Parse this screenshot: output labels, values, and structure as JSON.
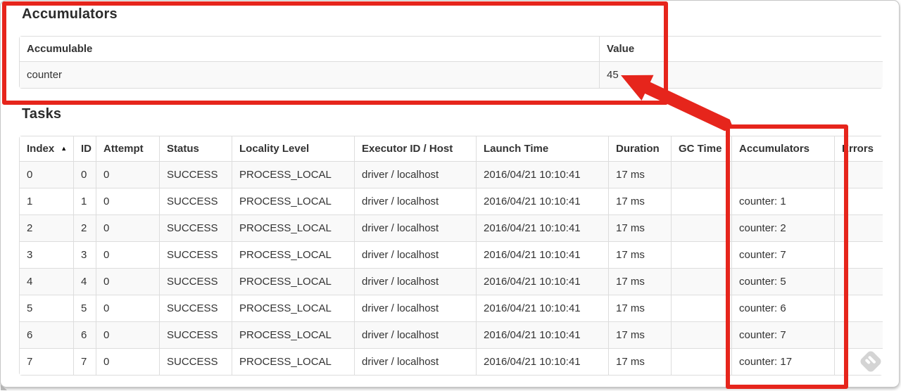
{
  "accumulators_section": {
    "title": "Accumulators",
    "table": {
      "headers": [
        "Accumulable",
        "Value"
      ],
      "rows": [
        [
          "counter",
          "45"
        ]
      ]
    }
  },
  "tasks_section": {
    "title": "Tasks",
    "table": {
      "headers": [
        "Index",
        "ID",
        "Attempt",
        "Status",
        "Locality Level",
        "Executor ID / Host",
        "Launch Time",
        "Duration",
        "GC Time",
        "Accumulators",
        "Errors"
      ],
      "sort_header": "Index",
      "sort_icon": "▲",
      "rows": [
        [
          "0",
          "0",
          "0",
          "SUCCESS",
          "PROCESS_LOCAL",
          "driver / localhost",
          "2016/04/21 10:10:41",
          "17 ms",
          "",
          "",
          ""
        ],
        [
          "1",
          "1",
          "0",
          "SUCCESS",
          "PROCESS_LOCAL",
          "driver / localhost",
          "2016/04/21 10:10:41",
          "17 ms",
          "",
          "counter: 1",
          ""
        ],
        [
          "2",
          "2",
          "0",
          "SUCCESS",
          "PROCESS_LOCAL",
          "driver / localhost",
          "2016/04/21 10:10:41",
          "17 ms",
          "",
          "counter: 2",
          ""
        ],
        [
          "3",
          "3",
          "0",
          "SUCCESS",
          "PROCESS_LOCAL",
          "driver / localhost",
          "2016/04/21 10:10:41",
          "17 ms",
          "",
          "counter: 7",
          ""
        ],
        [
          "4",
          "4",
          "0",
          "SUCCESS",
          "PROCESS_LOCAL",
          "driver / localhost",
          "2016/04/21 10:10:41",
          "17 ms",
          "",
          "counter: 5",
          ""
        ],
        [
          "5",
          "5",
          "0",
          "SUCCESS",
          "PROCESS_LOCAL",
          "driver / localhost",
          "2016/04/21 10:10:41",
          "17 ms",
          "",
          "counter: 6",
          ""
        ],
        [
          "6",
          "6",
          "0",
          "SUCCESS",
          "PROCESS_LOCAL",
          "driver / localhost",
          "2016/04/21 10:10:41",
          "17 ms",
          "",
          "counter: 7",
          ""
        ],
        [
          "7",
          "7",
          "0",
          "SUCCESS",
          "PROCESS_LOCAL",
          "driver / localhost",
          "2016/04/21 10:10:41",
          "17 ms",
          "",
          "counter: 17",
          ""
        ]
      ]
    }
  },
  "annotations": {
    "color": "#e6251c"
  },
  "watermark_icon": "skitch-logo"
}
